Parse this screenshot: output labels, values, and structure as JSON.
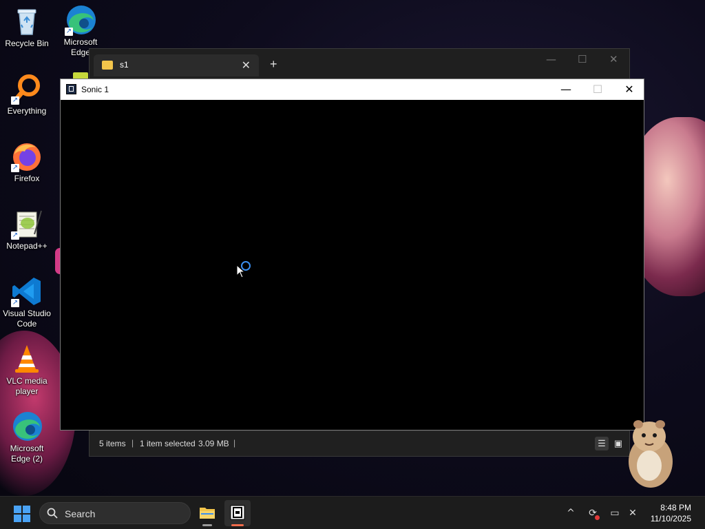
{
  "desktop": {
    "icons": [
      {
        "label": "Recycle Bin"
      },
      {
        "label": "Microsoft Edge"
      },
      {
        "label": "Everything"
      },
      {
        "label": "Firefox"
      },
      {
        "label": "Notepad++"
      },
      {
        "label": "Visual Studio Code"
      },
      {
        "label": "VLC media player"
      },
      {
        "label": "Microsoft Edge (2)"
      }
    ]
  },
  "explorer": {
    "tab_title": "s1",
    "close_tab_glyph": "✕",
    "new_tab_glyph": "+",
    "status": {
      "items": "5 items",
      "selected": "1 item selected",
      "size": "3.09 MB",
      "separator": "|"
    }
  },
  "sonic_window": {
    "title": "Sonic 1",
    "minimize_glyph": "—",
    "maximize_glyph": "☐",
    "close_glyph": "✕"
  },
  "taskbar": {
    "search_label": "Search",
    "clock": {
      "time": "8:48 PM",
      "date": "11/10/2025"
    },
    "tray_chevron": "^"
  },
  "colors": {
    "accent": "#3b8ff0",
    "active_indicator": "#f06b4b"
  }
}
